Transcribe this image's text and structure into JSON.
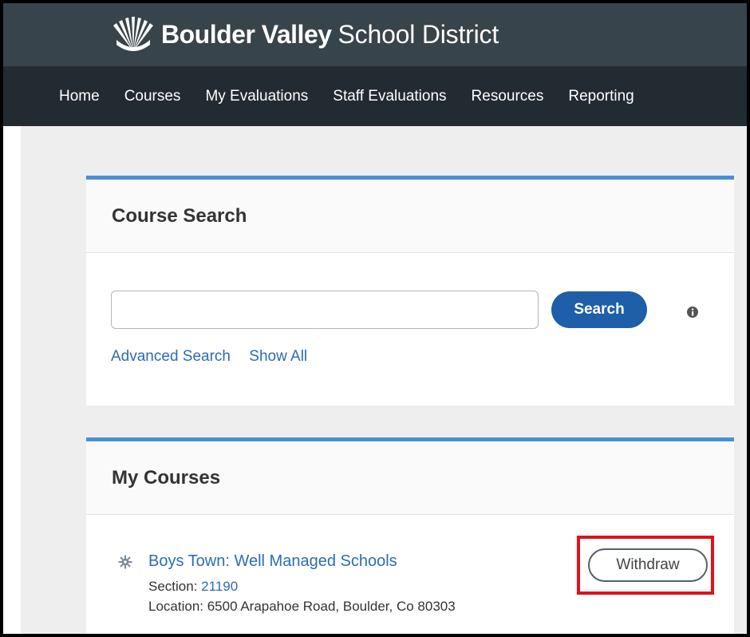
{
  "header": {
    "brand_bold": "Boulder Valley",
    "brand_regular": "School District"
  },
  "nav": {
    "items": [
      {
        "label": "Home"
      },
      {
        "label": "Courses"
      },
      {
        "label": "My Evaluations"
      },
      {
        "label": "Staff Evaluations"
      },
      {
        "label": "Resources"
      },
      {
        "label": "Reporting"
      }
    ]
  },
  "course_search": {
    "title": "Course Search",
    "input_value": "",
    "search_button": "Search",
    "info_icon": "info-circle-icon",
    "links": {
      "advanced": "Advanced Search",
      "show_all": "Show All"
    }
  },
  "my_courses": {
    "title": "My Courses",
    "courses": [
      {
        "icon": "gear-icon",
        "title": "Boys Town: Well Managed Schools",
        "section_label": "Section:",
        "section_number": "21190",
        "location": "Location: 6500 Arapahoe Road, Boulder, Co 80303",
        "withdraw_button": "Withdraw"
      }
    ]
  },
  "colors": {
    "brand_bar": "#37444b",
    "nav_bar": "#222b30",
    "accent": "#4a8fd6",
    "link": "#2d6cb5",
    "primary_button": "#1f5ea8",
    "highlight": "#e0121a"
  }
}
